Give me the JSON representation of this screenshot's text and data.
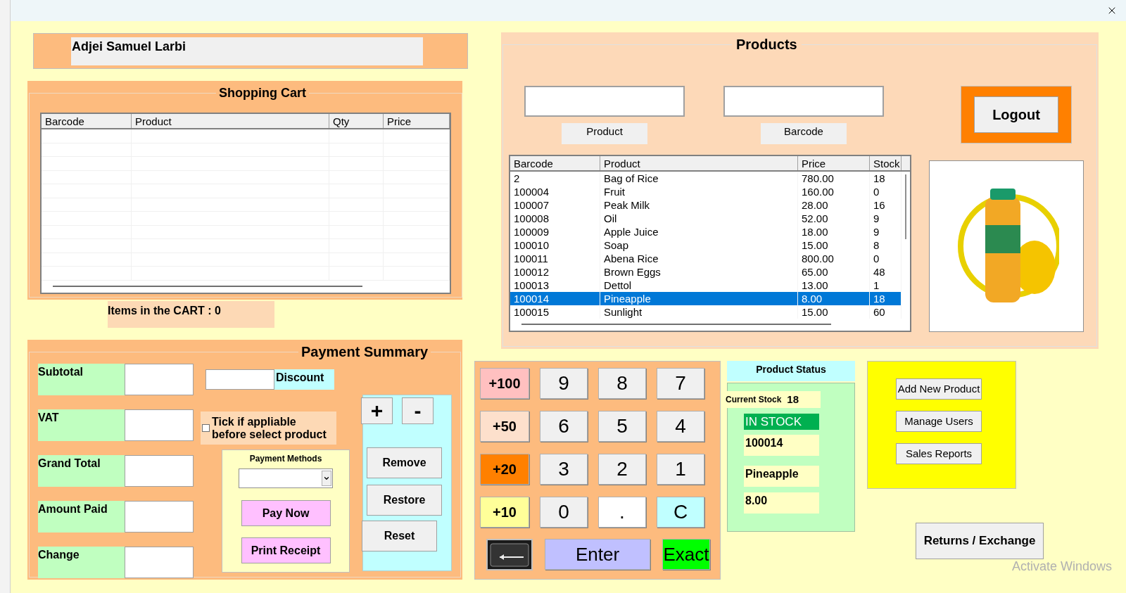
{
  "user_name": "Adjei Samuel Larbi",
  "cart": {
    "title": "Shopping Cart",
    "columns": [
      "Barcode",
      "Product",
      "Qty",
      "Price"
    ],
    "items_label": "Items in the CART : 0"
  },
  "payment": {
    "title": "Payment Summary",
    "fields": [
      {
        "label": "Subtotal"
      },
      {
        "label": "VAT"
      },
      {
        "label": "Grand Total"
      },
      {
        "label": "Amount Paid"
      },
      {
        "label": "Change"
      }
    ],
    "discount_label": "Discount",
    "vat_checkbox": {
      "label": "Tick if appliable before select product",
      "checked": false
    },
    "methods_title": "Payment Methods",
    "pay_buttons": [
      "Pay Now",
      "Print Receipt"
    ],
    "qty_buttons": [
      "+",
      "-"
    ],
    "cart_buttons": [
      "Remove",
      "Restore",
      "Reset"
    ]
  },
  "products": {
    "title": "Products",
    "search_labels": [
      "Product",
      "Barcode"
    ],
    "logout": "Logout",
    "columns": [
      "Barcode",
      "Product",
      "Price",
      "Stock"
    ],
    "rows": [
      {
        "cells": [
          "2",
          "Bag of Rice",
          "780.00",
          "18"
        ],
        "selected": false
      },
      {
        "cells": [
          "100004",
          "Fruit",
          "160.00",
          "0"
        ],
        "selected": false
      },
      {
        "cells": [
          "100007",
          "Peak Milk",
          "28.00",
          "16"
        ],
        "selected": false
      },
      {
        "cells": [
          "100008",
          "Oil",
          "52.00",
          "9"
        ],
        "selected": false
      },
      {
        "cells": [
          "100009",
          "Apple Juice",
          "18.00",
          "9"
        ],
        "selected": false
      },
      {
        "cells": [
          "100010",
          "Soap",
          "15.00",
          "8"
        ],
        "selected": false
      },
      {
        "cells": [
          "100011",
          "Abena Rice",
          "800.00",
          "0"
        ],
        "selected": false
      },
      {
        "cells": [
          "100012",
          "Brown Eggs",
          "65.00",
          "48"
        ],
        "selected": false
      },
      {
        "cells": [
          "100013",
          "Dettol",
          "13.00",
          "1"
        ],
        "selected": false
      },
      {
        "cells": [
          "100014",
          "Pineapple",
          "8.00",
          "18"
        ],
        "selected": true
      },
      {
        "cells": [
          "100015",
          "Sunlight",
          "15.00",
          "60"
        ],
        "selected": false
      }
    ]
  },
  "keypad": {
    "rows": [
      [
        {
          "label": "+100",
          "kind": "amount",
          "color": "#ffc0c0"
        },
        {
          "label": "9",
          "kind": "digit",
          "color": "#f0f0f0"
        },
        {
          "label": "8",
          "kind": "digit",
          "color": "#f0f0f0"
        },
        {
          "label": "7",
          "kind": "digit",
          "color": "#f0f0f0"
        }
      ],
      [
        {
          "label": "+50",
          "kind": "amount",
          "color": "#fde0cc"
        },
        {
          "label": "6",
          "kind": "digit",
          "color": "#f0f0f0"
        },
        {
          "label": "5",
          "kind": "digit",
          "color": "#f0f0f0"
        },
        {
          "label": "4",
          "kind": "digit",
          "color": "#f0f0f0"
        }
      ],
      [
        {
          "label": "+20",
          "kind": "amount",
          "color": "#ff8000"
        },
        {
          "label": "3",
          "kind": "digit",
          "color": "#f0f0f0"
        },
        {
          "label": "2",
          "kind": "digit",
          "color": "#f0f0f0"
        },
        {
          "label": "1",
          "kind": "digit",
          "color": "#f0f0f0"
        }
      ],
      [
        {
          "label": "+10",
          "kind": "amount",
          "color": "#ffff99"
        },
        {
          "label": "0",
          "kind": "digit",
          "color": "#f0f0f0"
        },
        {
          "label": ".",
          "kind": "digit",
          "color": "#ffffff"
        },
        {
          "label": "C",
          "kind": "digit",
          "color": "#c0ffff"
        }
      ]
    ],
    "action_keys": [
      {
        "kind": "backspace",
        "color": "#1a1a1a"
      },
      {
        "label": "Enter",
        "kind": "wide",
        "color": "#c0c0ff"
      },
      {
        "label": "Exact",
        "kind": "action",
        "color": "#00ff00"
      }
    ]
  },
  "status": {
    "title": "Product Status",
    "stock_label": "Current Stock",
    "stock_value": "18",
    "stock_state": {
      "text": "IN STOCK",
      "kind": "in_stock"
    },
    "barcode": "100014",
    "name": "Pineapple",
    "price": "8.00"
  },
  "admin_buttons": [
    "Add New Product",
    "Manage Users",
    "Sales Reports"
  ],
  "returns_button": "Returns / Exchange",
  "os_notice": "Activate Windows"
}
